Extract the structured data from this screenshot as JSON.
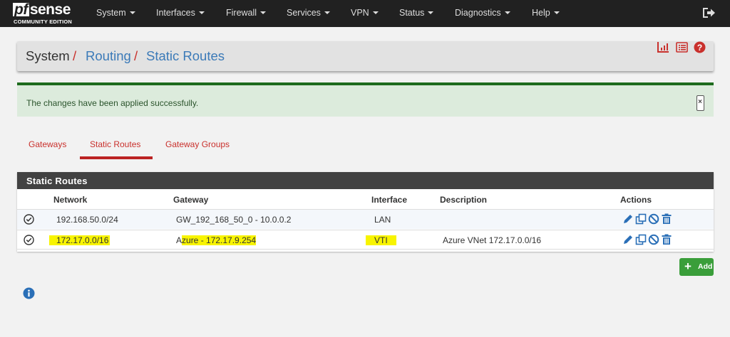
{
  "brand": {
    "logo": "pfsense",
    "logo_pf": "pf",
    "logo_rest": "sense",
    "edition": "COMMUNITY EDITION"
  },
  "nav": {
    "items": [
      {
        "label": "System"
      },
      {
        "label": "Interfaces"
      },
      {
        "label": "Firewall"
      },
      {
        "label": "Services"
      },
      {
        "label": "VPN"
      },
      {
        "label": "Status"
      },
      {
        "label": "Diagnostics"
      },
      {
        "label": "Help"
      }
    ],
    "logout_icon": "sign-out-icon"
  },
  "breadcrumb": {
    "root": "System",
    "sep": "/",
    "section": "Routing",
    "page": "Static Routes",
    "icons": [
      "chart-icon",
      "list-icon",
      "help-icon"
    ]
  },
  "alert": {
    "message": "The changes have been applied successfully.",
    "close_icon": "close-icon"
  },
  "tabs": [
    {
      "label": "Gateways",
      "active": false
    },
    {
      "label": "Static Routes",
      "active": true
    },
    {
      "label": "Gateway Groups",
      "active": false
    }
  ],
  "table": {
    "title": "Static Routes",
    "columns": [
      "Network",
      "Gateway",
      "Interface",
      "Description",
      "Actions"
    ],
    "rows": [
      {
        "network": "192.168.50.0/24",
        "gateway": "GW_192_168_50_0 - 10.0.0.2",
        "interface": "LAN",
        "description": ""
      },
      {
        "network": "172.17.0.0/16",
        "gateway_prefix": "A",
        "gateway_rest": "zure - 172.17.9.254",
        "interface": "VTI",
        "description": "Azure VNet 172.17.0.0/16"
      }
    ]
  },
  "add_button": {
    "label": "Add"
  },
  "colors": {
    "navbar": "#212121",
    "accent_red": "#c9302c",
    "link_blue": "#3b7ab8",
    "success_green": "#3a9e3a",
    "highlight": "#f8f400"
  }
}
